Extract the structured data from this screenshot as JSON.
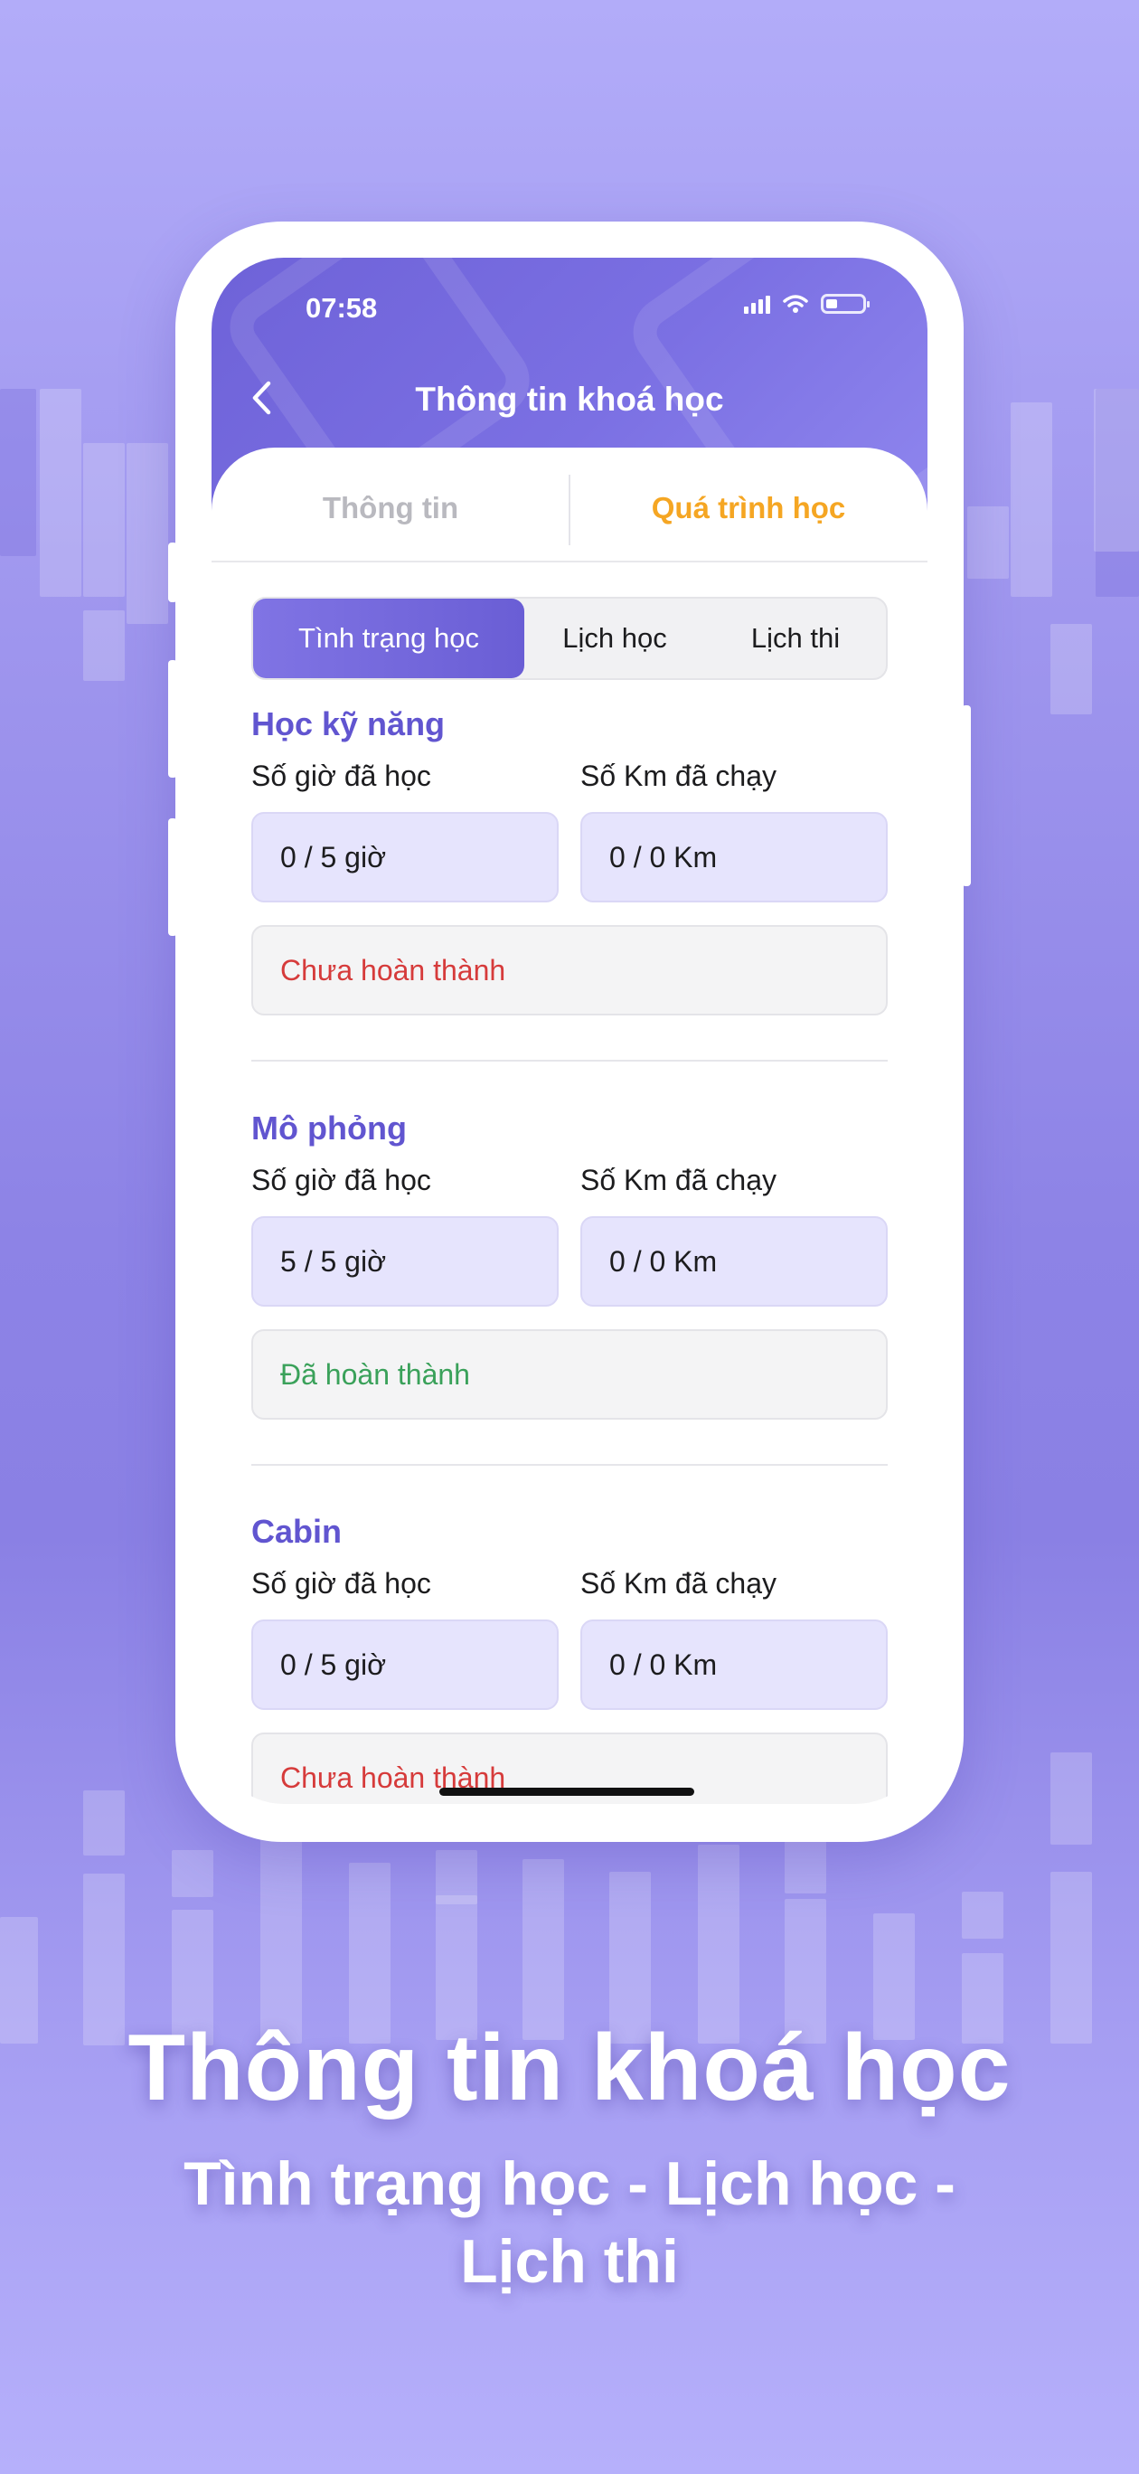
{
  "status_bar": {
    "time": "07:58"
  },
  "header": {
    "title": "Thông tin khoá học"
  },
  "tabs": [
    {
      "label": "Thông tin",
      "active": false
    },
    {
      "label": "Quá trình học",
      "active": true
    }
  ],
  "segments": [
    {
      "label": "Tình trạng học",
      "active": true
    },
    {
      "label": "Lịch học",
      "active": false
    },
    {
      "label": "Lịch thi",
      "active": false
    }
  ],
  "sections": [
    {
      "title": "Học kỹ năng",
      "hours_label": "Số giờ đã học",
      "km_label": "Số Km đã chạy",
      "hours_value": "0 / 5 giờ",
      "km_value": "0 / 0 Km",
      "status": "Chưa hoàn thành",
      "status_color": "#d63b3b"
    },
    {
      "title": "Mô phỏng",
      "hours_label": "Số giờ đã học",
      "km_label": "Số Km đã chạy",
      "hours_value": "5 / 5 giờ",
      "km_value": "0 / 0 Km",
      "status": "Đã hoàn thành",
      "status_color": "#3aa15a"
    },
    {
      "title": "Cabin",
      "hours_label": "Số giờ đã học",
      "km_label": "Số Km đã chạy",
      "hours_value": "0 / 5 giờ",
      "km_value": "0 / 0 Km",
      "status": "Chưa hoàn thành",
      "status_color": "#d63b3b"
    }
  ],
  "promo": {
    "title": "Thông tin khoá học",
    "subtitle_line1": "Tình trạng học - Lịch học -",
    "subtitle_line2": "Lịch thi"
  },
  "colors": {
    "accent": "#6155d0",
    "tab_active": "#f5a623",
    "header": "#7166db"
  }
}
